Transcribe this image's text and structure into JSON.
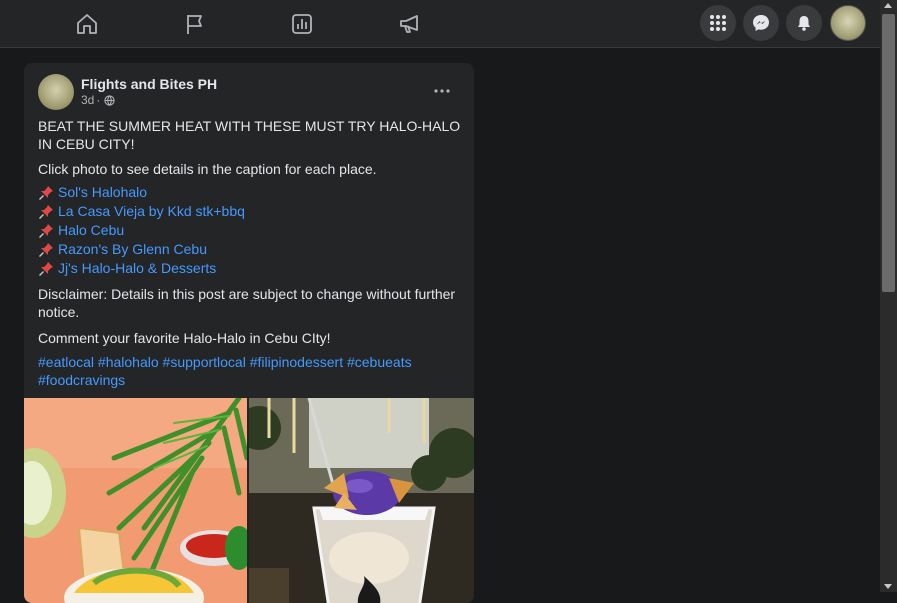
{
  "nav": {
    "icons": [
      "home-icon",
      "pages-flag-icon",
      "insights-chart-icon",
      "ads-megaphone-icon"
    ],
    "right": [
      "menu-grid-icon",
      "messenger-icon",
      "notifications-bell-icon"
    ]
  },
  "post": {
    "page_name": "Flights and Bites PH",
    "time": "3d",
    "separator": "·",
    "audience_icon": "globe-icon",
    "more_label": "•••",
    "headline": "BEAT THE SUMMER HEAT WITH THESE MUST TRY HALO-HALO IN CEBU CITY!",
    "instruction": "Click photo to see details in the caption for each place.",
    "places": [
      "Sol's Halohalo",
      "La Casa Vieja by Kkd stk+bbq",
      "Halo Cebu",
      "Razon's By Glenn Cebu",
      "Jj's Halo-Halo & Desserts"
    ],
    "place_icon": "pushpin-icon",
    "disclaimer": "Disclaimer: Details in this post are subject to change without further notice.",
    "cta": "Comment your favorite Halo-Halo in Cebu CIty!",
    "hashtags": "#eatlocal #halohalo #supportlocal #filipinodessert #cebueats #foodcravings"
  },
  "colors": {
    "page_bg": "#18191a",
    "card_bg": "#242526",
    "link": "#4599ff",
    "text": "#e4e6eb",
    "muted": "#b0b3b8"
  }
}
